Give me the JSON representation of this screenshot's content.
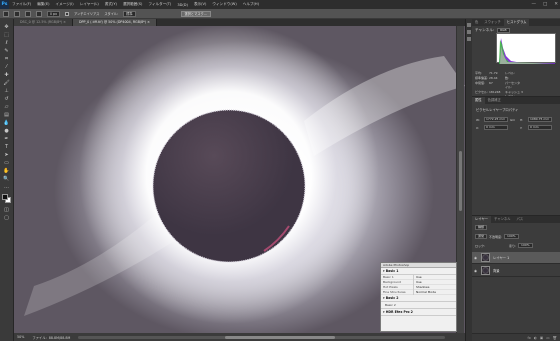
{
  "app": {
    "logo": "Ps"
  },
  "menu": [
    "ファイル(F)",
    "編集(E)",
    "イメージ(I)",
    "レイヤー(L)",
    "書式(Y)",
    "選択範囲(S)",
    "フィルター(T)",
    "3D(D)",
    "表示(V)",
    "ウィンドウ(W)",
    "ヘルプ(H)"
  ],
  "window_controls": [
    "—",
    "□",
    "✕"
  ],
  "options_bar": {
    "feather_value": "0 px",
    "antialias_label": "アンチエイリアス",
    "style_label": "スタイル:",
    "style_value": "標準",
    "refine_button": "選択とマスク..."
  },
  "tabs": [
    {
      "label": "DSC_0 @ 12.5% (RGB/8*) ×",
      "active": false
    },
    {
      "label": "DPP_0 (.tiff.tif) @ 50% (DP4004, RGB/8*) ×",
      "active": true
    }
  ],
  "tools": [
    "move-tool",
    "marquee-tool",
    "lasso-tool",
    "quick-select-tool",
    "crop-tool",
    "eyedropper-tool",
    "healing-tool",
    "brush-tool",
    "stamp-tool",
    "history-brush-tool",
    "eraser-tool",
    "gradient-tool",
    "blur-tool",
    "dodge-tool",
    "pen-tool",
    "type-tool",
    "path-select-tool",
    "shape-tool",
    "hand-tool",
    "zoom-tool",
    "more-tool"
  ],
  "status_bar": {
    "zoom": "50%",
    "doc_info": "ファイル：88.8M/88.8M"
  },
  "panels": {
    "histogram": {
      "tabs": [
        "色",
        "スウォッチ",
        "ヒストグラム"
      ],
      "active_tab": "ヒストグラム",
      "channel_label": "チャンネル:",
      "channel_value": "RGB",
      "source_label": "ソース:",
      "source_value": "画像全体",
      "stats": [
        [
          "平均:",
          "71.79",
          "レベル:",
          ""
        ],
        [
          "標準偏差:",
          "28.44",
          "数:",
          ""
        ],
        [
          "中間値:",
          "67",
          "パーセンタイル:",
          ""
        ],
        [
          "ピクセル:",
          "181248",
          "キャッシュレベル:",
          "3"
        ]
      ]
    },
    "properties": {
      "tabs": [
        "属性",
        "色調補正"
      ],
      "title": "ピクセルレイヤープロパティ",
      "w_label": "W:",
      "w_value": "1772.25 mm",
      "h_label": "H:",
      "h_value": "1080.75 mm",
      "x_label": "X:",
      "x_value": "0 mm",
      "y_label": "Y:",
      "y_value": "0 mm",
      "link_label": "GO"
    },
    "layers": {
      "tabs": [
        "レイヤー",
        "チャンネル",
        "パス"
      ],
      "kind_label": "種類",
      "blend_mode": "通常",
      "opacity_label": "不透明度:",
      "opacity_value": "100%",
      "lock_label": "ロック:",
      "fill_label": "塗り:",
      "fill_value": "100%",
      "items": [
        {
          "name": "レイヤー 1",
          "selected": true
        },
        {
          "name": "背景",
          "selected": false
        }
      ],
      "footer_icons": [
        "fx",
        "◐",
        "▣",
        "▭",
        "🗑"
      ]
    }
  },
  "float_panel": {
    "title": "Adobe Photoshop",
    "sections": [
      {
        "title": "▾ Basic 1",
        "rows": [
          [
            "Basic 1",
            "Use"
          ],
          [
            "Background",
            "Use"
          ],
          [
            "Hot Pixels",
            "Shadows"
          ],
          [
            "Fine Structures",
            "Normal Mode"
          ]
        ]
      },
      {
        "title": "▾ Basic 2",
        "rows": []
      },
      {
        "title": "▾ HDR Efex Pro 2",
        "rows": []
      }
    ],
    "list_items": [
      "Basic 2"
    ]
  },
  "canvas": {
    "subject": "solar eclipse corona",
    "colors": {
      "moon": "#4a3f4b",
      "corona": "#ffffff",
      "prominence": "#c0507a"
    }
  }
}
